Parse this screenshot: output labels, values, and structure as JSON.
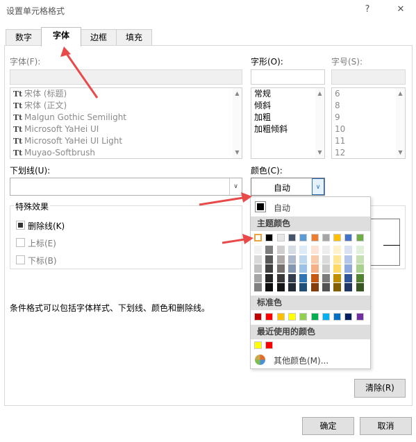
{
  "window": {
    "title": "设置单元格格式",
    "help": "?",
    "close": "✕"
  },
  "tabs": [
    {
      "label": "数字"
    },
    {
      "label": "字体"
    },
    {
      "label": "边框"
    },
    {
      "label": "填充"
    }
  ],
  "font": {
    "label": "字体(F):",
    "value": "",
    "list": [
      "宋体 (标题)",
      "宋体 (正文)",
      "Malgun Gothic Semilight",
      "Microsoft YaHei UI",
      "Microsoft YaHei UI Light",
      "Muyao-Softbrush"
    ],
    "icon": "truetype-icon"
  },
  "style": {
    "label": "字形(O):",
    "value": "",
    "list": [
      "常规",
      "倾斜",
      "加粗",
      "加粗倾斜"
    ]
  },
  "size": {
    "label": "字号(S):",
    "value": "",
    "list": [
      "6",
      "8",
      "9",
      "10",
      "11",
      "12"
    ]
  },
  "underline": {
    "label": "下划线(U):",
    "value": ""
  },
  "color": {
    "label": "颜色(C):",
    "value": "自动"
  },
  "effects": {
    "title": "特殊效果",
    "strikethrough": {
      "label": "删除线(K)",
      "checked": true
    },
    "superscript": {
      "label": "上标(E)",
      "checked": false
    },
    "subscript": {
      "label": "下标(B)",
      "checked": false
    }
  },
  "preview_area": {
    "border_color": "#7a7a7a"
  },
  "note": "条件格式可以包括字体样式、下划线、颜色和删除线。",
  "clear_button": "清除(R)",
  "ok_button": "确定",
  "cancel_button": "取消",
  "color_popup": {
    "auto_label": "自动",
    "theme_header": "主题颜色",
    "standard_header": "标准色",
    "recent_header": "最近使用的颜色",
    "more_label": "其他颜色(M)...",
    "theme_top": [
      "#ffffff",
      "#000000",
      "#e7e6e6",
      "#44546a",
      "#5b9bd5",
      "#ed7d31",
      "#a5a5a5",
      "#ffc000",
      "#4472c4",
      "#70ad47"
    ],
    "theme_shades": [
      [
        "#f2f2f2",
        "#d9d9d9",
        "#bfbfbf",
        "#a6a6a6",
        "#808080"
      ],
      [
        "#7f7f7f",
        "#595959",
        "#404040",
        "#262626",
        "#0d0d0d"
      ],
      [
        "#d0cece",
        "#aeaaaa",
        "#757171",
        "#3a3838",
        "#161616"
      ],
      [
        "#d6dce4",
        "#adb9ca",
        "#8497b0",
        "#333f4f",
        "#222a35"
      ],
      [
        "#ddebf7",
        "#bdd7ee",
        "#9bc2e6",
        "#2f75b5",
        "#1f4e78"
      ],
      [
        "#fce4d6",
        "#f8cbad",
        "#f4b084",
        "#c65911",
        "#833c0c"
      ],
      [
        "#ededed",
        "#dbdbdb",
        "#c9c9c9",
        "#7b7b7b",
        "#525252"
      ],
      [
        "#fff2cc",
        "#ffe699",
        "#ffd966",
        "#bf8f00",
        "#806000"
      ],
      [
        "#d9e1f2",
        "#b4c6e7",
        "#8ea9db",
        "#305496",
        "#203764"
      ],
      [
        "#e2efda",
        "#c6e0b4",
        "#a9d08e",
        "#548235",
        "#375623"
      ]
    ],
    "standard": [
      "#c00000",
      "#ff0000",
      "#ffc000",
      "#ffff00",
      "#92d050",
      "#00b050",
      "#00b0f0",
      "#0070c0",
      "#002060",
      "#7030a0"
    ],
    "recent": [
      "#ffff00",
      "#ff0000"
    ]
  },
  "accent": "#e84a4a"
}
